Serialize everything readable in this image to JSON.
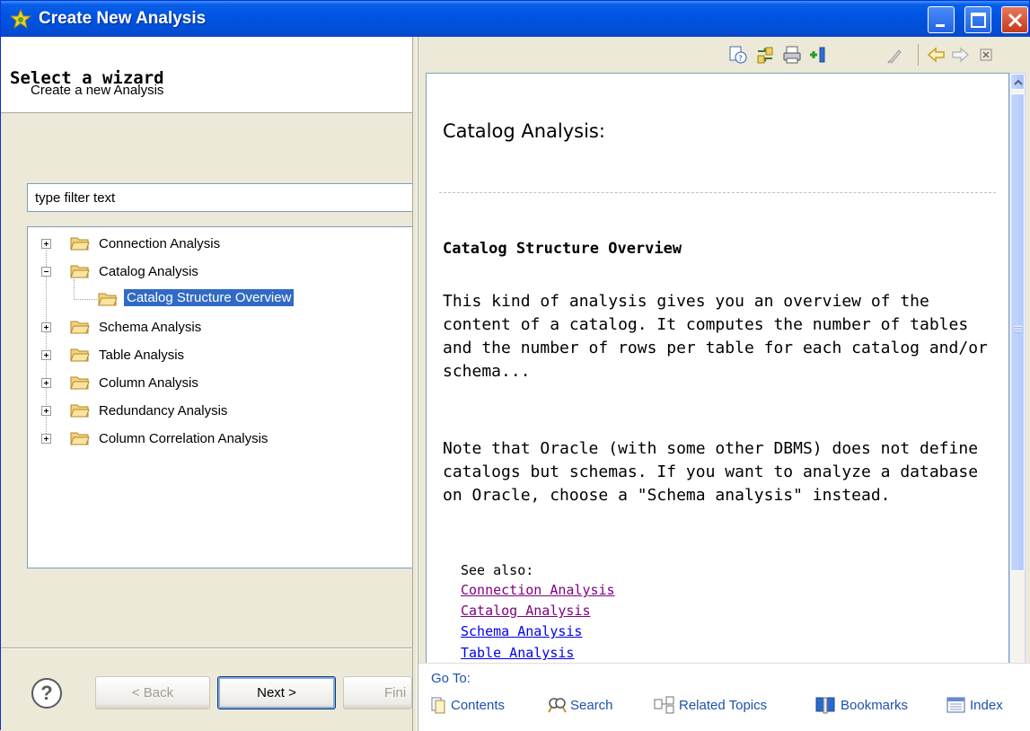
{
  "window": {
    "title": "Create New Analysis"
  },
  "wizard": {
    "title": "Select a wizard",
    "description": "Create a new Analysis",
    "filter_value": "type filter text"
  },
  "tree": {
    "items": [
      {
        "label": "Connection Analysis",
        "expanded": false
      },
      {
        "label": "Catalog Analysis",
        "expanded": true
      },
      {
        "label": "Catalog Structure Overview",
        "selected": true,
        "child": true
      },
      {
        "label": "Schema Analysis",
        "expanded": false
      },
      {
        "label": "Table Analysis",
        "expanded": false
      },
      {
        "label": "Column Analysis",
        "expanded": false
      },
      {
        "label": "Redundancy Analysis",
        "expanded": false
      },
      {
        "label": "Column Correlation Analysis",
        "expanded": false
      }
    ]
  },
  "buttons": {
    "back": "< Back",
    "next": "Next >",
    "finish": "Fini"
  },
  "help": {
    "heading": "Catalog Analysis:",
    "subheading": "Catalog Structure Overview",
    "para1": "This kind of analysis gives you an overview of the content of a catalog. It computes the number of tables and the number of rows per table for each catalog and/or schema...",
    "para2": "Note that Oracle (with some other DBMS) does not define catalogs but schemas. If you want to analyze a database on Oracle, choose a \"Schema analysis\" instead.",
    "see_also": "See also:",
    "links": [
      "Connection Analysis",
      "Catalog Analysis",
      "Schema Analysis",
      "Table Analysis"
    ]
  },
  "goto": {
    "label": "Go To:",
    "items": [
      "Contents",
      "Search",
      "Related Topics",
      "Bookmarks",
      "Index"
    ]
  },
  "colors": {
    "titlebar": "#0054e3",
    "selection": "#316ac5",
    "link": "#0000ee",
    "visited_link": "#800080",
    "goto_text": "#1e50b0"
  }
}
